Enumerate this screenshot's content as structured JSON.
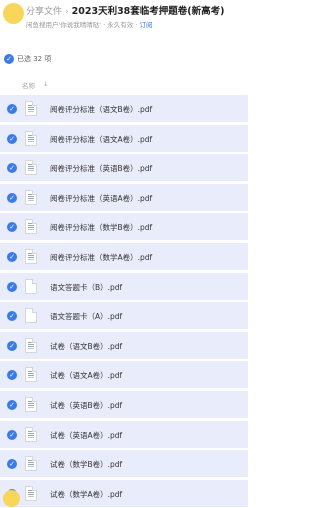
{
  "header": {
    "breadcrumb_root": "分享文件",
    "breadcrumb_sep": "›",
    "title": "2023天利38套临考押题卷(新高考)",
    "info_text": "闲鱼搜用户'你说我晴晴哒' · 永久有效 · ",
    "info_link": "订阅"
  },
  "selection": {
    "check_icon": "check-circle-icon",
    "label": "已选 32 项"
  },
  "columns": {
    "name": "名称",
    "sort_icon": "↓"
  },
  "files": [
    {
      "name": "阅卷评分标准（语文B卷）.pdf",
      "icon": "doc"
    },
    {
      "name": "阅卷评分标准（语文A卷）.pdf",
      "icon": "doc"
    },
    {
      "name": "阅卷评分标准（英语B卷）.pdf",
      "icon": "doc"
    },
    {
      "name": "阅卷评分标准（英语A卷）.pdf",
      "icon": "doc"
    },
    {
      "name": "阅卷评分标准（数学B卷）.pdf",
      "icon": "doc"
    },
    {
      "name": "阅卷评分标准（数学A卷）.pdf",
      "icon": "doc"
    },
    {
      "name": "语文答题卡（B）.pdf",
      "icon": "blank"
    },
    {
      "name": "语文答题卡（A）.pdf",
      "icon": "blank"
    },
    {
      "name": "试卷（语文B卷）.pdf",
      "icon": "doc"
    },
    {
      "name": "试卷（语文A卷）.pdf",
      "icon": "doc"
    },
    {
      "name": "试卷（英语B卷）.pdf",
      "icon": "doc"
    },
    {
      "name": "试卷（英语A卷）.pdf",
      "icon": "doc"
    },
    {
      "name": "试卷（数学B卷）.pdf",
      "icon": "doc"
    },
    {
      "name": "试卷（数学A卷）.pdf",
      "icon": "doc"
    }
  ]
}
